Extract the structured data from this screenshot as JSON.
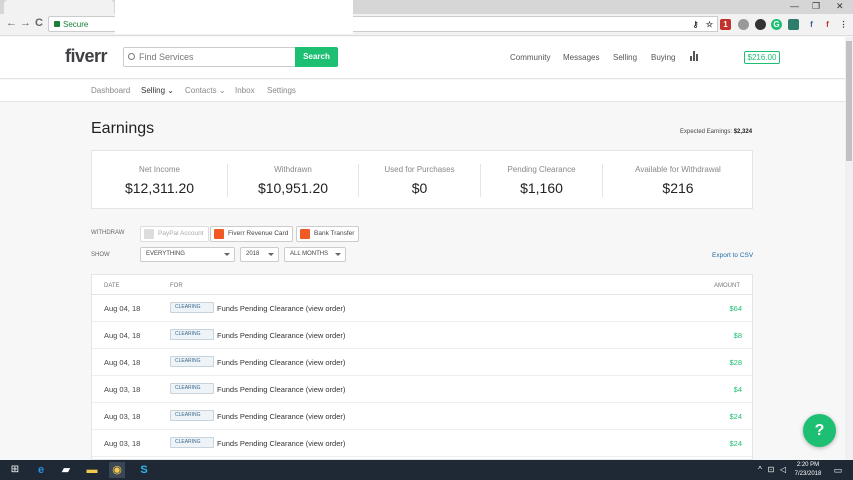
{
  "browser": {
    "address_prefix": "Secure",
    "back_glyph": "←",
    "forward_glyph": "→",
    "reload_glyph": "C",
    "win_min": "—",
    "win_max": "❐",
    "win_close": "✕",
    "ext_red_badge": "1"
  },
  "header": {
    "logo": "fiverr",
    "search_placeholder": "Find Services",
    "search_button": "Search",
    "links": [
      "Community",
      "Messages",
      "Selling",
      "Buying"
    ],
    "balance": "$216.00"
  },
  "subnav": {
    "items": [
      "Dashboard",
      "Selling",
      "Contacts",
      "Inbox",
      "Settings"
    ],
    "active": "Selling"
  },
  "page": {
    "title": "Earnings",
    "expected_label": "Expected Earnings:",
    "expected_value": "$2,324"
  },
  "stats": [
    {
      "label": "Net Income",
      "value": "$12,311.20"
    },
    {
      "label": "Withdrawn",
      "value": "$10,951.20"
    },
    {
      "label": "Used for Purchases",
      "value": "$0"
    },
    {
      "label": "Pending Clearance",
      "value": "$1,160"
    },
    {
      "label": "Available for Withdrawal",
      "value": "$216"
    }
  ],
  "withdraw": {
    "label": "WITHDRAW",
    "paypal": "PayPal Account",
    "card": "Fiverr Revenue Card",
    "bank": "Bank Transfer"
  },
  "filters": {
    "label": "SHOW",
    "type": "EVERYTHING",
    "year": "2018",
    "month": "ALL MONTHS",
    "export": "Export to CSV"
  },
  "table": {
    "headers": {
      "date": "DATE",
      "for": "FOR",
      "amount": "AMOUNT"
    },
    "rows": [
      {
        "date": "Aug 04, 18",
        "status": "CLEARING",
        "desc": "Funds Pending Clearance (view order)",
        "amount": "$64"
      },
      {
        "date": "Aug 04, 18",
        "status": "CLEARING",
        "desc": "Funds Pending Clearance (view order)",
        "amount": "$8"
      },
      {
        "date": "Aug 04, 18",
        "status": "CLEARING",
        "desc": "Funds Pending Clearance (view order)",
        "amount": "$28"
      },
      {
        "date": "Aug 03, 18",
        "status": "CLEARING",
        "desc": "Funds Pending Clearance (view order)",
        "amount": "$4"
      },
      {
        "date": "Aug 03, 18",
        "status": "CLEARING",
        "desc": "Funds Pending Clearance (view order)",
        "amount": "$24"
      },
      {
        "date": "Aug 03, 18",
        "status": "CLEARING",
        "desc": "Funds Pending Clearance (view order)",
        "amount": "$24"
      }
    ]
  },
  "help": "?",
  "taskbar": {
    "time": "2:20 PM",
    "date": "7/23/2018"
  },
  "colors": {
    "brand_green": "#1dbf73",
    "link_blue": "#1f6aa5"
  }
}
